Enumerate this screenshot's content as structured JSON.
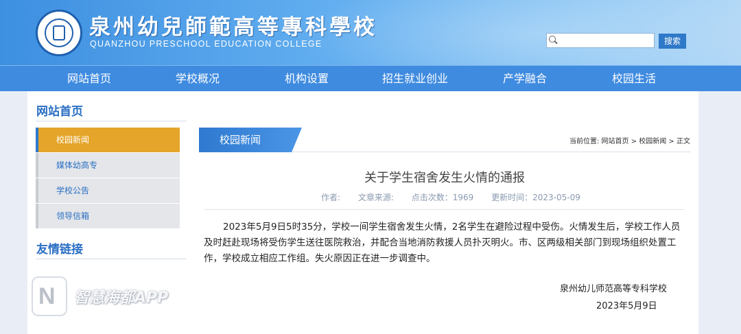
{
  "header": {
    "college_name_cn": "泉州幼兒師範高等專科學校",
    "college_name_en": "QUANZHOU PRESCHOOL EDUCATION COLLEGE",
    "search_placeholder": "",
    "search_button": "搜索",
    "colors": {
      "header_start": "#3d8fe0",
      "nav_bg": "#3f8be0",
      "accent_orange": "#e5a52a"
    }
  },
  "nav": {
    "items": [
      "网站首页",
      "学校概况",
      "机构设置",
      "招生就业创业",
      "产学融合",
      "校园生活"
    ]
  },
  "sidebar": {
    "title": "网站首页",
    "items": [
      {
        "label": "校园新闻",
        "active": true
      },
      {
        "label": "媒体幼高专",
        "active": false
      },
      {
        "label": "学校公告",
        "active": false
      },
      {
        "label": "领导信箱",
        "active": false
      }
    ],
    "links_title": "友情链接"
  },
  "content": {
    "tab_label": "校园新闻",
    "breadcrumb": "当前位置: 网站首页  > 校园新闻  > 正文",
    "title": "关于学生宿舍发生火情的通报",
    "meta": {
      "author": "作者:",
      "source": "文章来源:",
      "clicks": "点击次数：1969",
      "updated": "更新时间：2023-05-09"
    },
    "body": "2023年5月9日5时35分，学校一间学生宿舍发生火情，2名学生在避险过程中受伤。火情发生后，学校工作人员及时赶赴现场将受伤学生送往医院救治，并配合当地消防救援人员扑灭明火。市、区两级相关部门到现场组织处置工作，学校成立相应工作组。失火原因正在进一步调查中。",
    "sign_org": "泉州幼儿师范高等专科学校",
    "sign_date": "2023年5月9日"
  },
  "watermark": {
    "badge_letter": "N",
    "text": "智慧海都APP"
  }
}
